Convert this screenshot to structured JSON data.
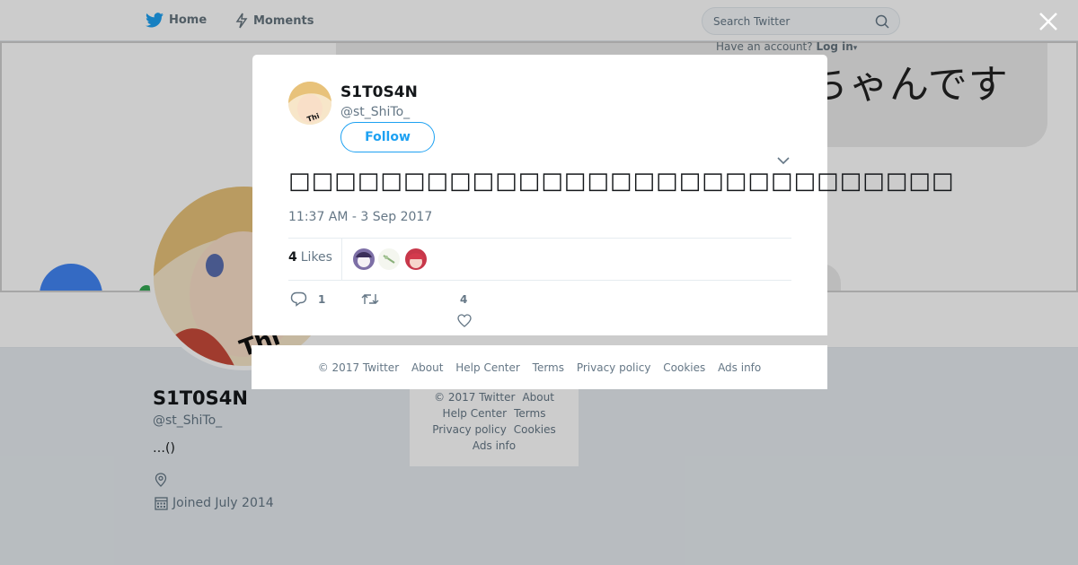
{
  "nav": {
    "home_label": "Home",
    "moments_label": "Moments",
    "search_placeholder": "Search Twitter",
    "have_account": "Have an account?",
    "login_label": "Log in"
  },
  "banner": {
    "speech_text": "ちゃんです"
  },
  "profile": {
    "name": "S1T0S4N",
    "handle": "@st_ShiTo_",
    "bio": "…()",
    "joined": "Joined July 2014"
  },
  "page_footer": {
    "copyright": "© 2017 Twitter",
    "about": "About",
    "help_center": "Help Center",
    "terms": "Terms",
    "privacy": "Privacy policy",
    "cookies": "Cookies",
    "ads_info": "Ads info"
  },
  "tweet": {
    "author_name": "S1T0S4N",
    "author_handle": "@st_ShiTo_",
    "follow_label": "Follow",
    "text": "□□□□□□□□□□□□□□□□□□□□□□□□□□□□□",
    "timestamp": "11:37 AM - 3 Sep 2017",
    "likes_count": "4",
    "likes_label": "Likes",
    "reply_count": "1",
    "like_action_count": "4"
  },
  "modal_footer": {
    "copyright": "© 2017 Twitter",
    "about": "About",
    "help_center": "Help Center",
    "terms": "Terms",
    "privacy": "Privacy policy",
    "cookies": "Cookies",
    "ads_info": "Ads info"
  },
  "colors": {
    "accent": "#1da1f2",
    "secondary_text": "#657786"
  },
  "icons": [
    "twitter-bird-icon",
    "lightning-icon",
    "search-icon",
    "close-icon",
    "chevron-down-icon",
    "reply-icon",
    "retweet-icon",
    "heart-icon",
    "location-icon",
    "calendar-icon"
  ]
}
